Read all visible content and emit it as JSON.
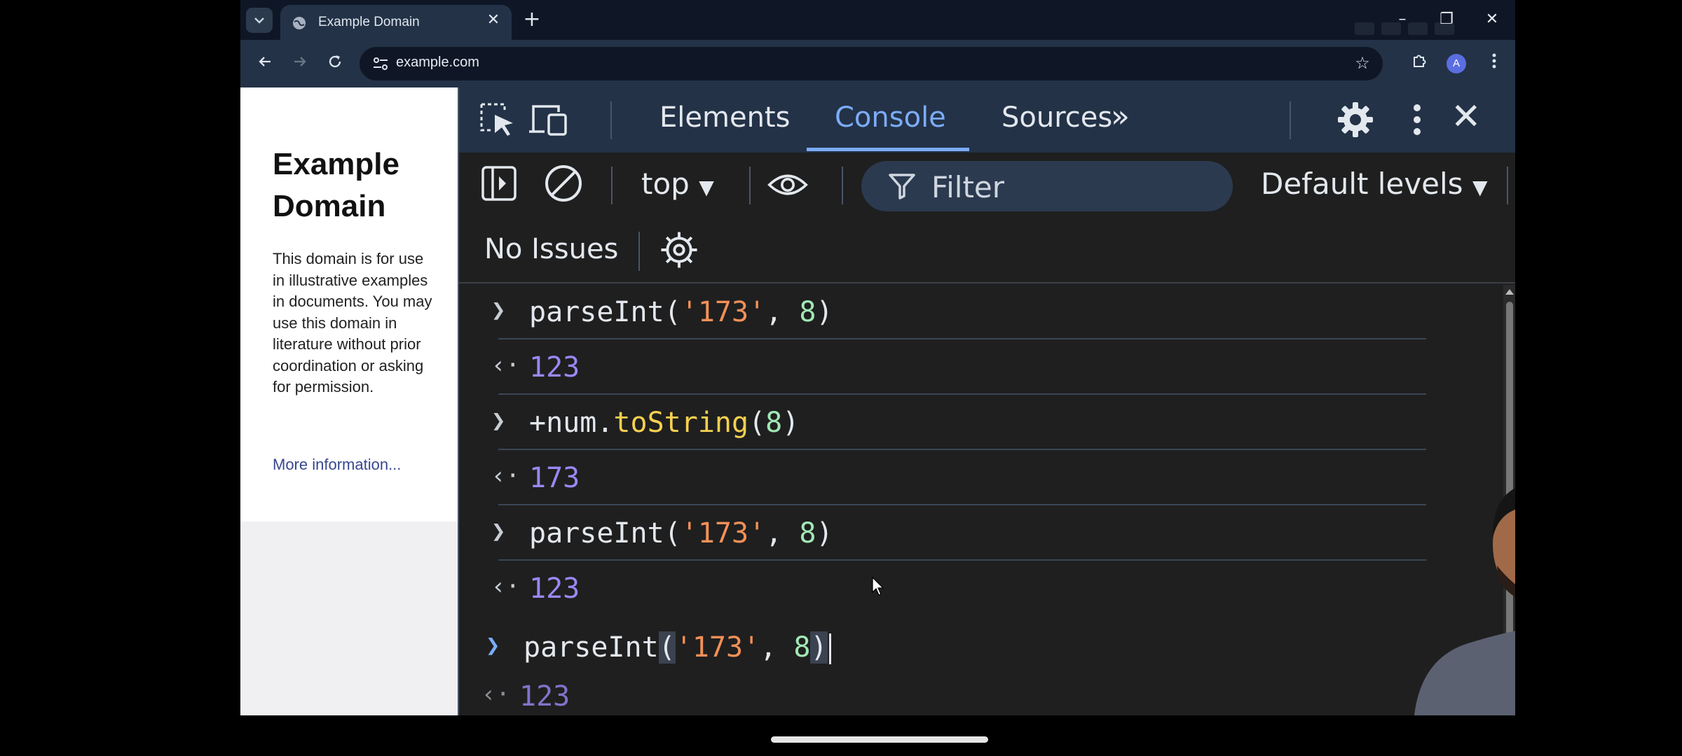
{
  "browser": {
    "tab": {
      "title": "Example Domain"
    },
    "toolbar": {
      "url": "example.com",
      "profile_initial": "A"
    }
  },
  "page": {
    "title": "Example Domain",
    "body": "This domain is for use in illustrative examples in documents. You may use this domain in literature without prior coordination or asking for permission.",
    "link": "More information..."
  },
  "devtools": {
    "tabs": [
      {
        "label": "Elements",
        "active": false
      },
      {
        "label": "Console",
        "active": true
      },
      {
        "label": "Sources",
        "active": false
      }
    ],
    "context": "top",
    "filter_placeholder": "Filter",
    "levels": "Default levels",
    "issues": "No Issues"
  },
  "console": {
    "entries": [
      {
        "type": "input",
        "text": "parseInt('173', 8)"
      },
      {
        "type": "output",
        "text": "123"
      },
      {
        "type": "input",
        "text": "+num.toString(8)"
      },
      {
        "type": "output",
        "text": "173"
      },
      {
        "type": "input",
        "text": "parseInt('173', 8)"
      },
      {
        "type": "output",
        "text": "123"
      }
    ],
    "current_input": "parseInt('173', 8)",
    "eager_result": "123"
  },
  "colors": {
    "accent": "#7cacf8",
    "string": "#f39058",
    "number": "#a1e7b5",
    "function": "#f7d04f",
    "result": "#9b87f5",
    "toolbar": "#233247"
  }
}
